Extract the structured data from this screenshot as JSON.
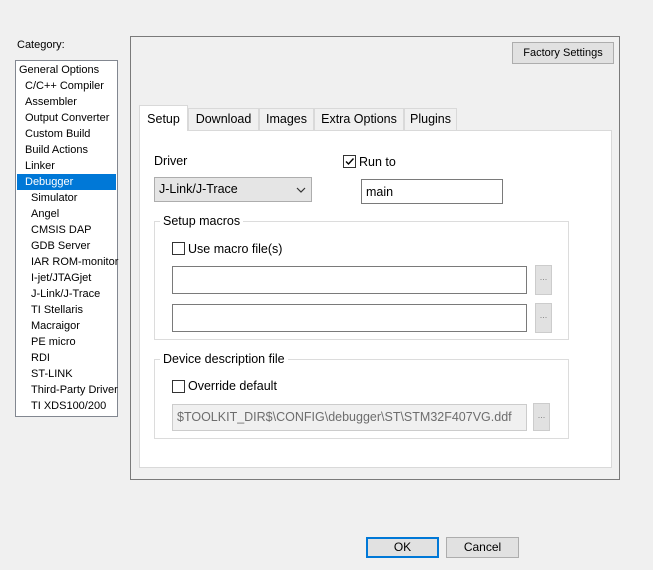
{
  "category": {
    "label": "Category:",
    "items": [
      {
        "label": "General Options",
        "indent": 0
      },
      {
        "label": "C/C++ Compiler",
        "indent": 1
      },
      {
        "label": "Assembler",
        "indent": 1
      },
      {
        "label": "Output Converter",
        "indent": 1
      },
      {
        "label": "Custom Build",
        "indent": 1
      },
      {
        "label": "Build Actions",
        "indent": 1
      },
      {
        "label": "Linker",
        "indent": 1
      },
      {
        "label": "Debugger",
        "indent": 1,
        "selected": true
      },
      {
        "label": "Simulator",
        "indent": 2
      },
      {
        "label": "Angel",
        "indent": 2
      },
      {
        "label": "CMSIS DAP",
        "indent": 2
      },
      {
        "label": "GDB Server",
        "indent": 2
      },
      {
        "label": "IAR ROM-monitor",
        "indent": 2
      },
      {
        "label": "I-jet/JTAGjet",
        "indent": 2
      },
      {
        "label": "J-Link/J-Trace",
        "indent": 2
      },
      {
        "label": "TI Stellaris",
        "indent": 2
      },
      {
        "label": "Macraigor",
        "indent": 2
      },
      {
        "label": "PE micro",
        "indent": 2
      },
      {
        "label": "RDI",
        "indent": 2
      },
      {
        "label": "ST-LINK",
        "indent": 2
      },
      {
        "label": "Third-Party Driver",
        "indent": 2
      },
      {
        "label": "TI XDS100/200",
        "indent": 2
      }
    ]
  },
  "factory_settings_label": "Factory Settings",
  "tabs": [
    "Setup",
    "Download",
    "Images",
    "Extra Options",
    "Plugins"
  ],
  "active_tab": "Setup",
  "setup": {
    "driver_label": "Driver",
    "driver_value": "J-Link/J-Trace",
    "run_to_label": "Run to",
    "run_to_checked": true,
    "run_to_value": "main",
    "setup_macros_title": "Setup macros",
    "use_macro_label": "Use macro file(s)",
    "use_macro_checked": false,
    "macro_file_1": "",
    "macro_file_2": "",
    "device_desc_title": "Device description file",
    "override_label": "Override default",
    "override_checked": false,
    "device_desc_path": "$TOOLKIT_DIR$\\CONFIG\\debugger\\ST\\STM32F407VG.ddf",
    "browse_label": "..."
  },
  "buttons": {
    "ok": "OK",
    "cancel": "Cancel"
  }
}
